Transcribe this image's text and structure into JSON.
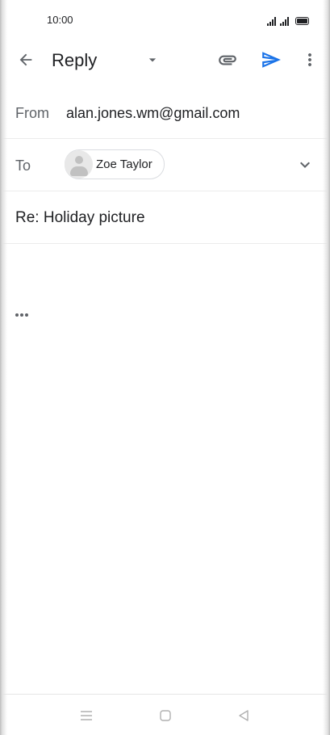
{
  "status_bar": {
    "time": "10:00"
  },
  "app_bar": {
    "title": "Reply",
    "icons": {
      "back": "arrow-back-icon",
      "dropdown": "dropdown-arrow-icon",
      "attach": "paperclip-icon",
      "send": "send-icon",
      "more": "more-vert-icon"
    },
    "accent_color": "#1a73e8"
  },
  "compose": {
    "from_label": "From",
    "from_value": "alan.jones.wm@gmail.com",
    "to_label": "To",
    "recipients": [
      {
        "name": "Zoe Taylor"
      }
    ],
    "subject": "Re: Holiday picture"
  },
  "nav_bar": {
    "icons": [
      "menu-icon",
      "home-icon",
      "back-triangle-icon"
    ]
  }
}
